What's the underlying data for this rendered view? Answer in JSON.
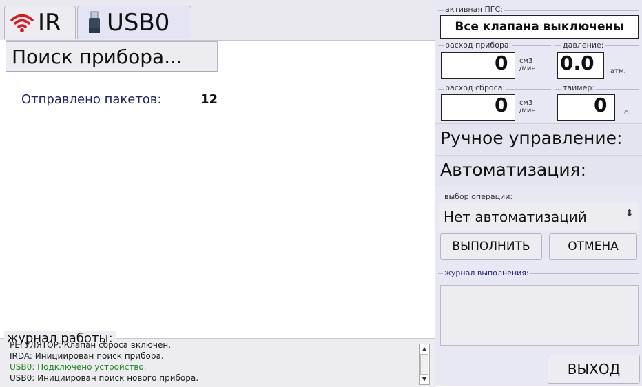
{
  "tabs": [
    {
      "label": "IR",
      "icon": "wifi-icon",
      "icon_color": "#e0161e"
    },
    {
      "label": "USB0",
      "icon": "usb-drive-icon"
    }
  ],
  "main": {
    "search_label": "Поиск прибора...",
    "packets_label": "Отправлено пакетов:",
    "packets_count": "12"
  },
  "log": {
    "title": "журнал работы:",
    "lines": [
      {
        "text": "РЕГУЛЯТОР: Клапан сброса включен.",
        "color": "#222222"
      },
      {
        "text": "IRDA: Инициирован поиск прибора.",
        "color": "#222222"
      },
      {
        "text": "USB0: Подключено устройство.",
        "color": "#1a8a1a"
      },
      {
        "text": "USB0: Инициирован поиск нового прибора.",
        "color": "#222222"
      }
    ]
  },
  "right": {
    "active_label": "активная ПГС:",
    "active_value": "Все клапана выключены",
    "flow_label": "расход прибора:",
    "flow_value": "0",
    "flow_unit_top": "см3",
    "flow_unit_bottom": "/мин",
    "pressure_label": "давление:",
    "pressure_value": "0.0",
    "pressure_unit": "атм.",
    "reset_flow_label": "расход сброса:",
    "reset_flow_value": "0",
    "reset_flow_unit_top": "см3",
    "reset_flow_unit_bottom": "/мин",
    "timer_label": "таймер:",
    "timer_value": "0",
    "timer_unit": "с.",
    "manual_title": "Ручное управление:",
    "auto_title": "Автоматизация:",
    "op_label": "выбор операции:",
    "op_value": "Нет автоматизаций",
    "execute_button": "ВЫПОЛНИТЬ",
    "cancel_button": "ОТМЕНА",
    "journal_label": "журнал выполнения:",
    "exit_button": "ВЫХОД"
  }
}
